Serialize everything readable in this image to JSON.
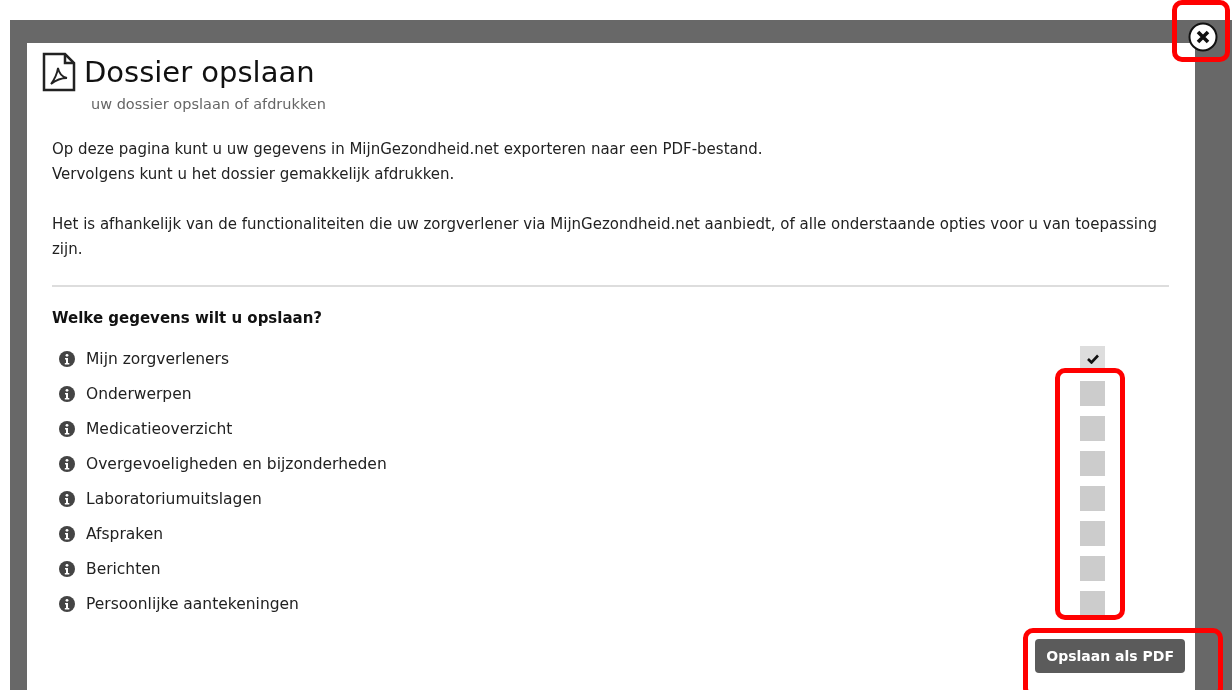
{
  "dialog": {
    "title": "Dossier opslaan",
    "subtitle": "uw dossier opslaan of afdrukken",
    "intro": [
      "Op deze pagina kunt u uw gegevens in MijnGezondheid.net exporteren naar een PDF-bestand.",
      "Vervolgens kunt u het dossier gemakkelijk afdrukken."
    ],
    "note": "Het is afhankelijk van de functionaliteiten die uw zorgverlener via MijnGezondheid.net aanbiedt, of alle onderstaande opties voor u van toepassing zijn.",
    "question": "Welke gegevens wilt u opslaan?",
    "options": [
      {
        "label": "Mijn zorgverleners",
        "checked": true
      },
      {
        "label": "Onderwerpen",
        "checked": false
      },
      {
        "label": "Medicatieoverzicht",
        "checked": false
      },
      {
        "label": "Overgevoeligheden en bijzonderheden",
        "checked": false
      },
      {
        "label": "Laboratoriumuitslagen",
        "checked": false
      },
      {
        "label": "Afspraken",
        "checked": false
      },
      {
        "label": "Berichten",
        "checked": false
      },
      {
        "label": "Persoonlijke aantekeningen",
        "checked": false
      }
    ],
    "button": "Opslaan als PDF"
  }
}
